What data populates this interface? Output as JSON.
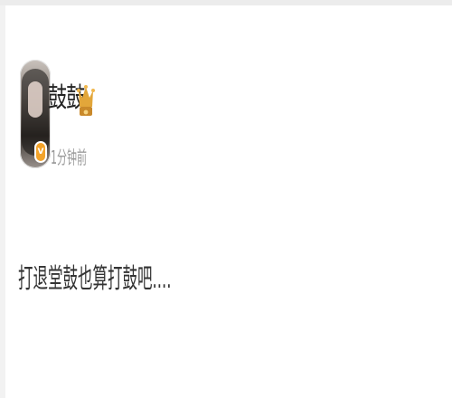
{
  "post": {
    "author": {
      "name": "鼓鼓",
      "vip_badge_glyph": "V",
      "crown_icon": "crown-icon"
    },
    "timestamp": "1分钟前",
    "content": "打退堂鼓也算打鼓吧...."
  },
  "colors": {
    "name_text": "#222222",
    "meta_text": "#9a9a9a",
    "body_text": "#333333",
    "vip_orange": "#f3a32a",
    "crown_gold": "#e2a63a"
  }
}
